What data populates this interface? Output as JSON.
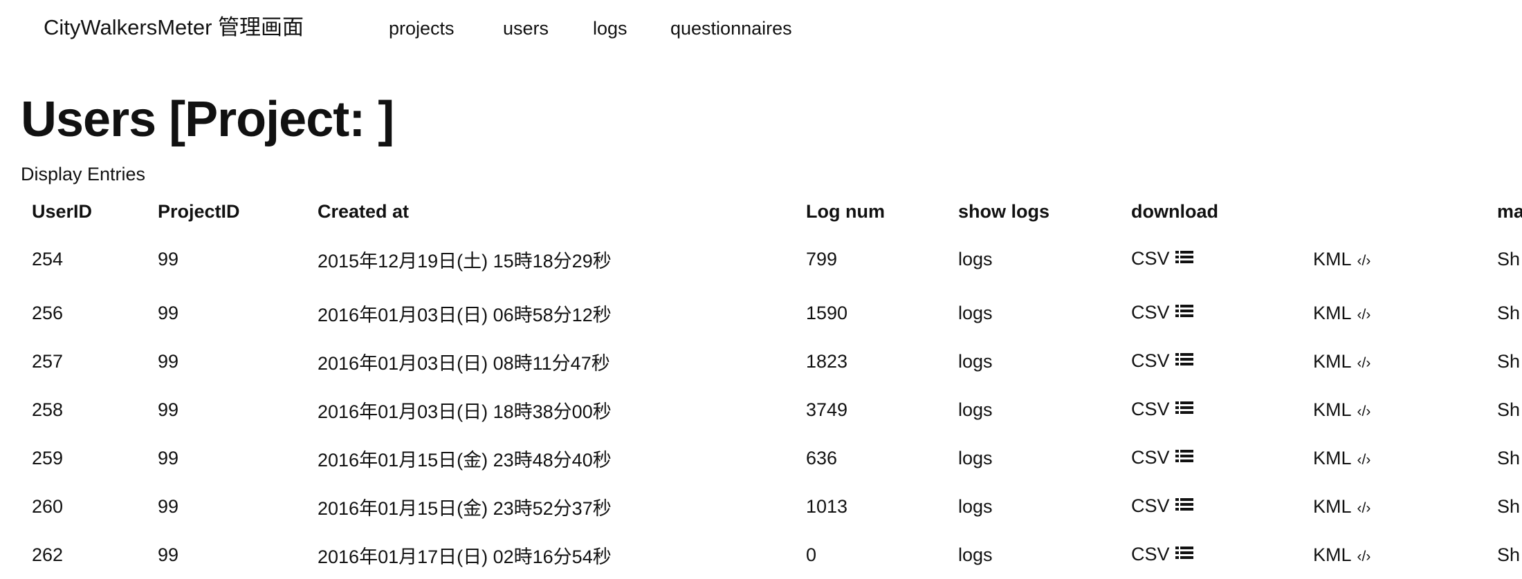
{
  "nav": {
    "brand": "CityWalkersMeter 管理画面",
    "links": [
      "projects",
      "users",
      "logs",
      "questionnaires"
    ]
  },
  "page": {
    "title": "Users [Project: ]",
    "display_entries": "Display Entries"
  },
  "table": {
    "headers": [
      "UserID",
      "ProjectID",
      "Created at",
      "Log num",
      "show logs",
      "download",
      "",
      "ma"
    ],
    "rows": [
      {
        "user_id": "254",
        "project_id": "99",
        "created_at": "2015年12月19日(土) 15時18分29秒",
        "log_num": "799",
        "logs": "logs",
        "csv": "CSV",
        "kml": "KML",
        "map": "Sh"
      },
      {
        "user_id": "256",
        "project_id": "99",
        "created_at": "2016年01月03日(日) 06時58分12秒",
        "log_num": "1590",
        "logs": "logs",
        "csv": "CSV",
        "kml": "KML",
        "map": "Sh"
      },
      {
        "user_id": "257",
        "project_id": "99",
        "created_at": "2016年01月03日(日) 08時11分47秒",
        "log_num": "1823",
        "logs": "logs",
        "csv": "CSV",
        "kml": "KML",
        "map": "Sh"
      },
      {
        "user_id": "258",
        "project_id": "99",
        "created_at": "2016年01月03日(日) 18時38分00秒",
        "log_num": "3749",
        "logs": "logs",
        "csv": "CSV",
        "kml": "KML",
        "map": "Sh"
      },
      {
        "user_id": "259",
        "project_id": "99",
        "created_at": "2016年01月15日(金) 23時48分40秒",
        "log_num": "636",
        "logs": "logs",
        "csv": "CSV",
        "kml": "KML",
        "map": "Sh"
      },
      {
        "user_id": "260",
        "project_id": "99",
        "created_at": "2016年01月15日(金) 23時52分37秒",
        "log_num": "1013",
        "logs": "logs",
        "csv": "CSV",
        "kml": "KML",
        "map": "Sh"
      },
      {
        "user_id": "262",
        "project_id": "99",
        "created_at": "2016年01月17日(日) 02時16分54秒",
        "log_num": "0",
        "logs": "logs",
        "csv": "CSV",
        "kml": "KML",
        "map": "Sh"
      }
    ]
  },
  "icons": {
    "csv": "list-icon",
    "kml": "code-icon"
  }
}
